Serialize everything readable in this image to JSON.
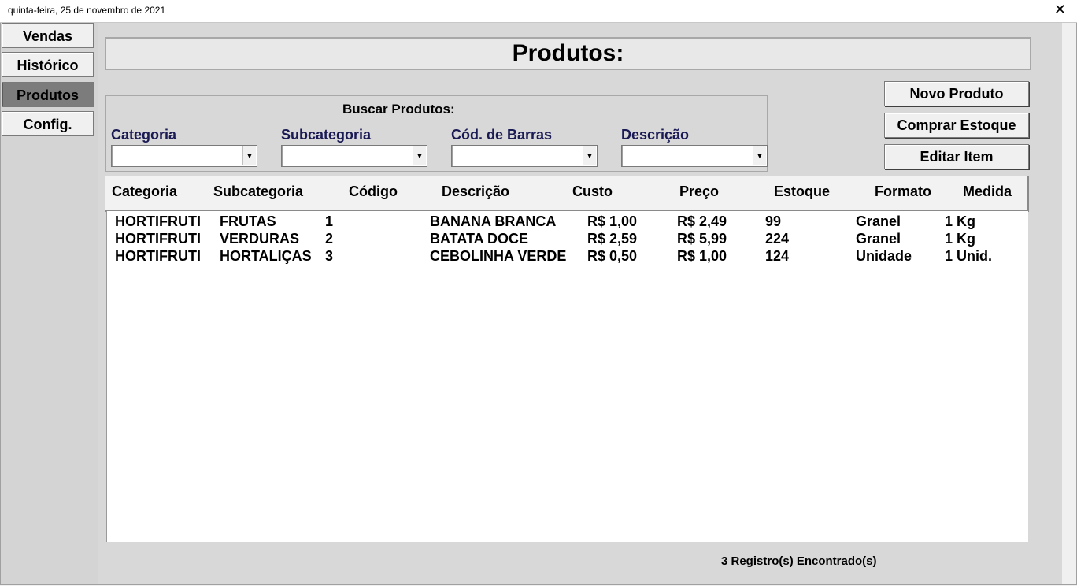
{
  "window": {
    "title": "quinta-feira, 25 de novembro de 2021",
    "close_glyph": "✕"
  },
  "sidebar": {
    "items": [
      {
        "label": "Vendas"
      },
      {
        "label": "Histórico"
      },
      {
        "label": "Produtos",
        "active": true
      },
      {
        "label": "Config."
      }
    ]
  },
  "page": {
    "title": "Produtos:"
  },
  "search": {
    "title": "Buscar Produtos:",
    "filters": [
      {
        "label": "Categoria",
        "value": ""
      },
      {
        "label": "Subcategoria",
        "value": ""
      },
      {
        "label": "Cód. de Barras",
        "value": ""
      },
      {
        "label": "Descrição",
        "value": ""
      }
    ]
  },
  "actions": {
    "new_product": "Novo Produto",
    "buy_stock": "Comprar Estoque",
    "edit_item": "Editar Item"
  },
  "table": {
    "columns": [
      "Categoria",
      "Subcategoria",
      "Código",
      "Descrição",
      "Custo",
      "Preço",
      "Estoque",
      "Formato",
      "Medida"
    ],
    "rows": [
      [
        "HORTIFRUTI",
        "FRUTAS",
        "1",
        "BANANA BRANCA",
        "R$ 1,00",
        "R$ 2,49",
        "99",
        "Granel",
        "1 Kg"
      ],
      [
        "HORTIFRUTI",
        "VERDURAS",
        "2",
        "BATATA DOCE",
        "R$ 2,59",
        "R$ 5,99",
        "224",
        "Granel",
        "1 Kg"
      ],
      [
        "HORTIFRUTI",
        "HORTALIÇAS",
        "3",
        "CEBOLINHA VERDE",
        "R$ 0,50",
        "R$ 1,00",
        "124",
        "Unidade",
        "1 Unid."
      ]
    ]
  },
  "footer": {
    "records": "3 Registro(s) Encontrado(s)"
  }
}
